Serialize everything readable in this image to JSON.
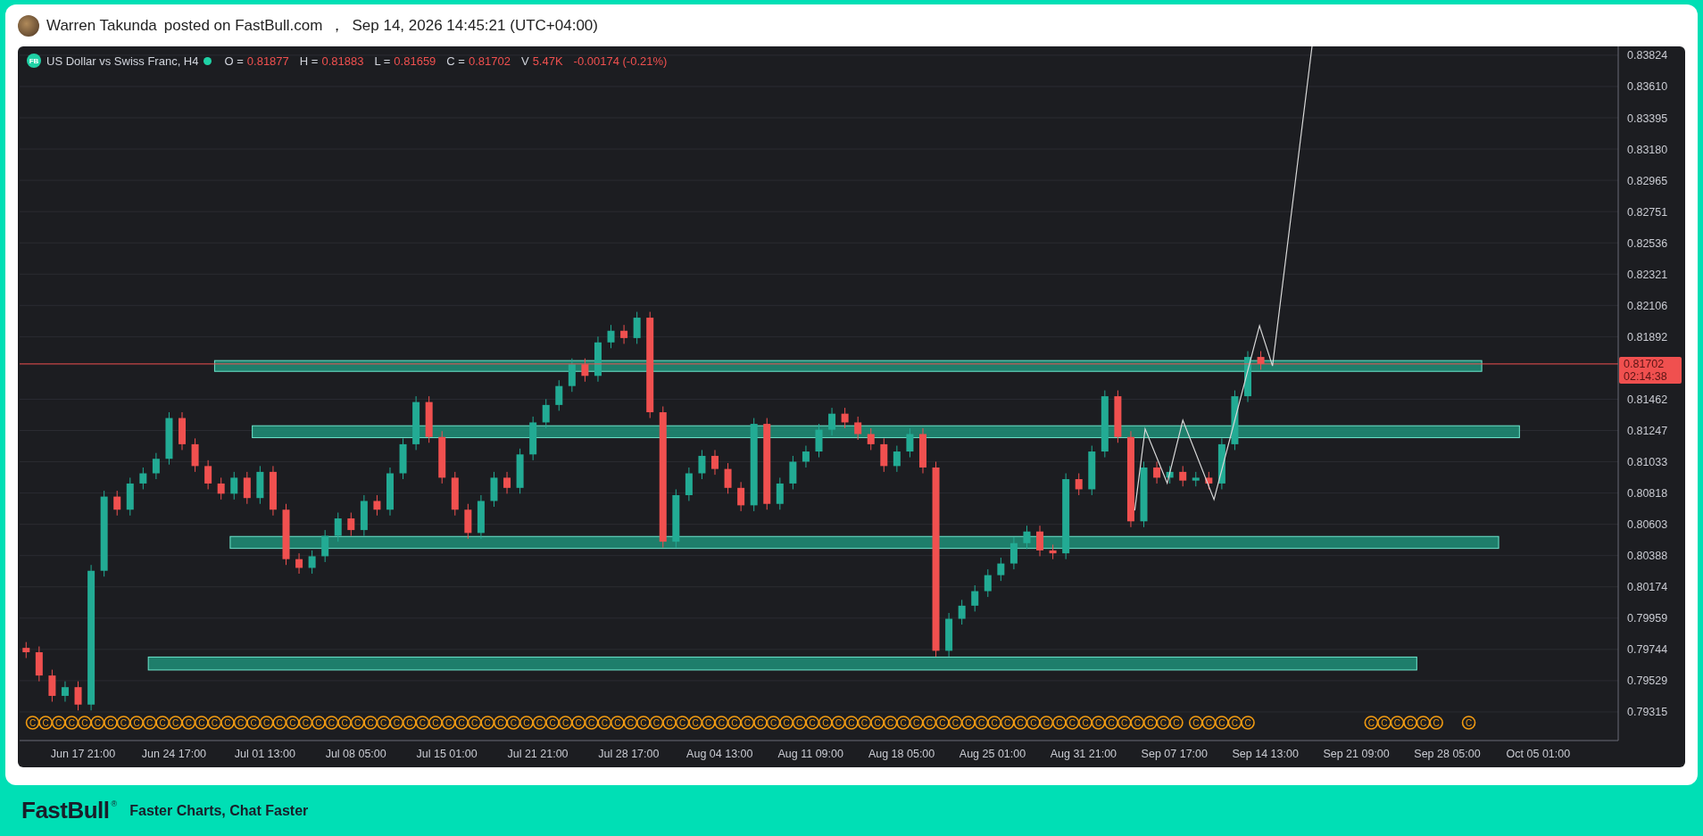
{
  "post": {
    "author": "Warren Takunda",
    "text": "posted on FastBull.com",
    "separator": "，",
    "timestamp": "Sep 14, 2026 14:45:21 (UTC+04:00)"
  },
  "chart": {
    "logo": "FB",
    "symbol": "US Dollar vs Swiss Franc, H4",
    "market_open": true,
    "ohlc": [
      {
        "label": "O =",
        "value": "0.81877"
      },
      {
        "label": "H =",
        "value": "0.81883"
      },
      {
        "label": "L =",
        "value": "0.81659"
      },
      {
        "label": "C =",
        "value": "0.81702"
      }
    ],
    "volume": {
      "label": "V",
      "value": "5.47K"
    },
    "change": "-0.00174 (-0.21%)",
    "last_price": {
      "price": "0.81702",
      "countdown": "02:14:38"
    },
    "price_axis": [
      "0.83824",
      "0.83610",
      "0.83395",
      "0.83180",
      "0.82965",
      "0.82751",
      "0.82536",
      "0.82321",
      "0.82106",
      "0.81892",
      "0.81462",
      "0.81247",
      "0.81033",
      "0.80818",
      "0.80603",
      "0.80388",
      "0.80174",
      "0.79959",
      "0.79744",
      "0.79529",
      "0.79315"
    ],
    "time_axis": [
      "Jun 17 21:00",
      "Jun 24 17:00",
      "Jul 01 13:00",
      "Jul 08 05:00",
      "Jul 15 01:00",
      "Jul 21 21:00",
      "Jul 28 17:00",
      "Aug 04 13:00",
      "Aug 11 09:00",
      "Aug 18 05:00",
      "Aug 25 01:00",
      "Aug 31 21:00",
      "Sep 07 17:00",
      "Sep 14 13:00",
      "Sep 21 09:00",
      "Sep 28 05:00",
      "Oct 05 01:00"
    ],
    "event_markers": [
      "C",
      "C",
      "C",
      "C",
      "C",
      "C",
      "C",
      "C",
      "C",
      "C",
      "C",
      "C",
      "C",
      "C",
      "C",
      "C",
      "C",
      "C",
      "C",
      "C",
      "C",
      "C",
      "C",
      "C",
      "C",
      "C",
      "C",
      "C",
      "C",
      "C",
      "C",
      "C",
      "C",
      "C",
      "C",
      "C",
      "C",
      "C",
      "C",
      "C",
      "C",
      "C",
      "C",
      "C",
      "C",
      "C",
      "C",
      "C",
      "C",
      "C",
      "C",
      "C",
      "C",
      "C",
      "C",
      "C",
      "C",
      "C",
      "C",
      "C",
      "C",
      "C",
      "C",
      "C",
      "C",
      "C",
      "C",
      "C",
      "C",
      "C",
      "C",
      "C",
      "C",
      "C",
      "C",
      "C",
      "C",
      "C",
      "C",
      "C",
      "C",
      "C",
      "C",
      "C",
      "C",
      "C",
      "C",
      "C",
      "C",
      "C",
      "C",
      "C",
      "C",
      "C",
      "C",
      "C",
      "C",
      "C",
      "C",
      "C",
      "C"
    ]
  },
  "footer": {
    "brand": "FastBull",
    "mark": "®",
    "tagline": "Faster Charts, Chat Faster"
  }
}
